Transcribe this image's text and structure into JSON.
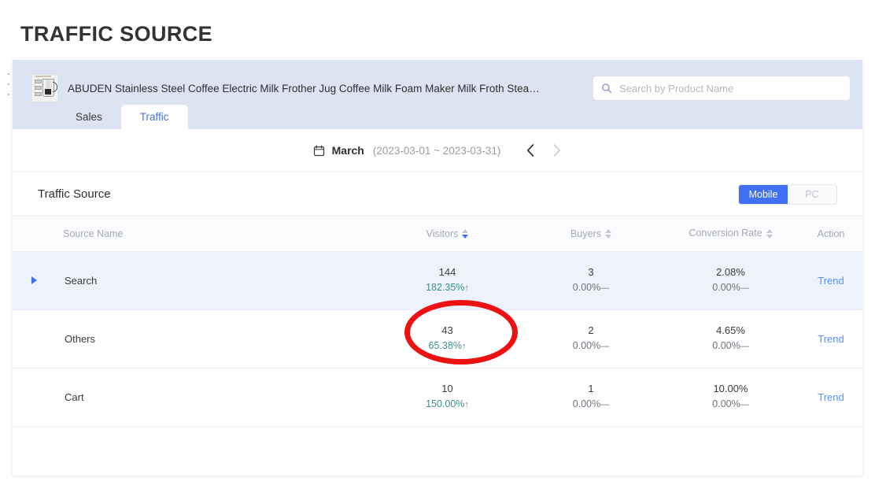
{
  "page": {
    "title": "TRAFFIC SOURCE"
  },
  "product": {
    "title": "ABUDEN Stainless Steel Coffee Electric Milk Frother Jug Coffee Milk Foam Maker Milk Froth Steam…",
    "thumbnail_alt": "milk-frother-jug-product-photo"
  },
  "search": {
    "placeholder": "Search by Product Name",
    "value": "",
    "icon": "search-icon"
  },
  "tabs": [
    {
      "label": "Sales",
      "active": false
    },
    {
      "label": "Traffic",
      "active": true
    }
  ],
  "date_bar": {
    "icon": "calendar-icon",
    "month": "March",
    "range": "(2023-03-01 ~ 2023-03-31)",
    "prev_icon": "chevron-left-icon",
    "next_icon": "chevron-right-icon",
    "next_disabled": true
  },
  "section": {
    "title": "Traffic Source",
    "device_toggle": {
      "options": [
        "Mobile",
        "PC"
      ],
      "selected": "Mobile"
    }
  },
  "table": {
    "columns": [
      {
        "label": "Source Name",
        "sortable": false
      },
      {
        "label": "Visitors",
        "sortable": true,
        "sort": "desc"
      },
      {
        "label": "Buyers",
        "sortable": true,
        "sort": "none"
      },
      {
        "label": "Conversion Rate",
        "sortable": true,
        "sort": "none"
      },
      {
        "label": "Action",
        "sortable": false
      }
    ],
    "rows": [
      {
        "source_name": "Search",
        "expandable": true,
        "highlighted": true,
        "visitors": "144",
        "visitors_delta": "182.35%",
        "visitors_trend": "up",
        "buyers": "3",
        "buyers_delta": "0.00%",
        "buyers_trend": "flat",
        "conversion_rate": "2.08%",
        "conversion_delta": "0.00%",
        "conversion_trend": "flat",
        "action": "Trend"
      },
      {
        "source_name": "Others",
        "expandable": false,
        "highlighted": false,
        "visitors": "43",
        "visitors_delta": "65.38%",
        "visitors_trend": "up",
        "buyers": "2",
        "buyers_delta": "0.00%",
        "buyers_trend": "flat",
        "conversion_rate": "4.65%",
        "conversion_delta": "0.00%",
        "conversion_trend": "flat",
        "action": "Trend"
      },
      {
        "source_name": "Cart",
        "expandable": false,
        "highlighted": false,
        "visitors": "10",
        "visitors_delta": "150.00%",
        "visitors_trend": "up",
        "buyers": "1",
        "buyers_delta": "0.00%",
        "buyers_trend": "flat",
        "conversion_rate": "10.00%",
        "conversion_delta": "0.00%",
        "conversion_trend": "flat",
        "action": "Trend"
      }
    ]
  },
  "annotation": {
    "shape": "ellipse",
    "color": "#ee1111",
    "targets": "visitors-cell-search-row"
  },
  "colors": {
    "accent_blue": "#4070f4",
    "link_blue": "#5b8ff0",
    "band_lavender": "#dde3f3",
    "row_highlight": "#eef2fd",
    "up_green": "#3b8f91",
    "annotation_red": "#ee1111"
  },
  "glyphs": {
    "arrow_up": "↑",
    "arrow_flat": "—"
  }
}
